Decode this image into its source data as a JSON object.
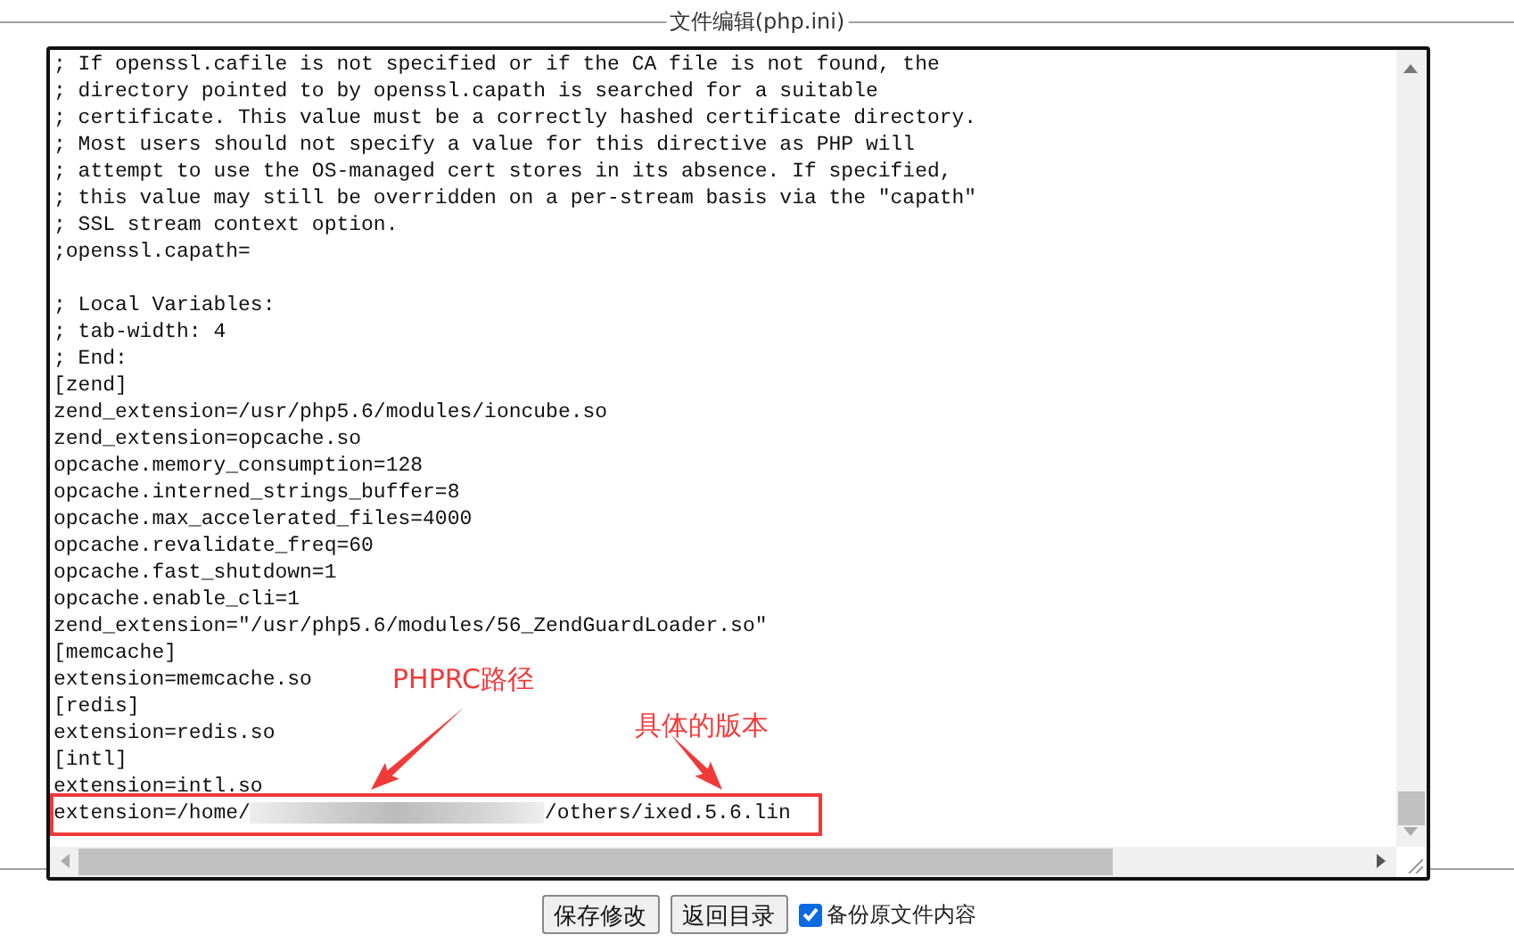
{
  "legend": "文件编辑(php.ini)",
  "lines": [
    {
      "kind": "text",
      "text": "; If openssl.cafile is not specified or if the CA file is not found, the"
    },
    {
      "kind": "text",
      "text": "; directory pointed to by openssl.capath is searched for a suitable"
    },
    {
      "kind": "text",
      "text": "; certificate. This value must be a correctly hashed certificate directory."
    },
    {
      "kind": "text",
      "text": "; Most users should not specify a value for this directive as PHP will"
    },
    {
      "kind": "text",
      "text": "; attempt to use the OS-managed cert stores in its absence. If specified,"
    },
    {
      "kind": "text",
      "text": "; this value may still be overridden on a per-stream basis via the \"capath\""
    },
    {
      "kind": "text",
      "text": "; SSL stream context option."
    },
    {
      "kind": "text",
      "text": ";openssl.capath="
    },
    {
      "kind": "blank"
    },
    {
      "kind": "text",
      "text": "; Local Variables:"
    },
    {
      "kind": "text",
      "text": "; tab-width: 4"
    },
    {
      "kind": "text",
      "text": "; End:"
    },
    {
      "kind": "text",
      "text": "[zend]"
    },
    {
      "kind": "text",
      "text": "zend_extension=/usr/php5.6/modules/ioncube.so"
    },
    {
      "kind": "text",
      "text": "zend_extension=opcache.so"
    },
    {
      "kind": "text",
      "text": "opcache.memory_consumption=128"
    },
    {
      "kind": "text",
      "text": "opcache.interned_strings_buffer=8"
    },
    {
      "kind": "text",
      "text": "opcache.max_accelerated_files=4000"
    },
    {
      "kind": "text",
      "text": "opcache.revalidate_freq=60"
    },
    {
      "kind": "text",
      "text": "opcache.fast_shutdown=1"
    },
    {
      "kind": "text",
      "text": "opcache.enable_cli=1"
    },
    {
      "kind": "text",
      "text": "zend_extension=\"/usr/php5.6/modules/56_ZendGuardLoader.so\""
    },
    {
      "kind": "text",
      "text": "[memcache]"
    },
    {
      "kind": "text",
      "text": "extension=memcache.so"
    },
    {
      "kind": "text",
      "text": "[redis]"
    },
    {
      "kind": "text",
      "text": "extension=redis.so"
    },
    {
      "kind": "text",
      "text": "[intl]"
    },
    {
      "kind": "text",
      "text": "extension=intl.so"
    },
    {
      "kind": "redacted",
      "before": "extension=/home/",
      "after": "/others/ixed.5.6.lin"
    }
  ],
  "annotations": [
    {
      "label": "PHPRC路径"
    },
    {
      "label": "具体的版本"
    }
  ],
  "buttons": [
    "保存修改",
    "返回目录"
  ],
  "backup": {
    "label": "备份原文件内容",
    "checked": true
  }
}
